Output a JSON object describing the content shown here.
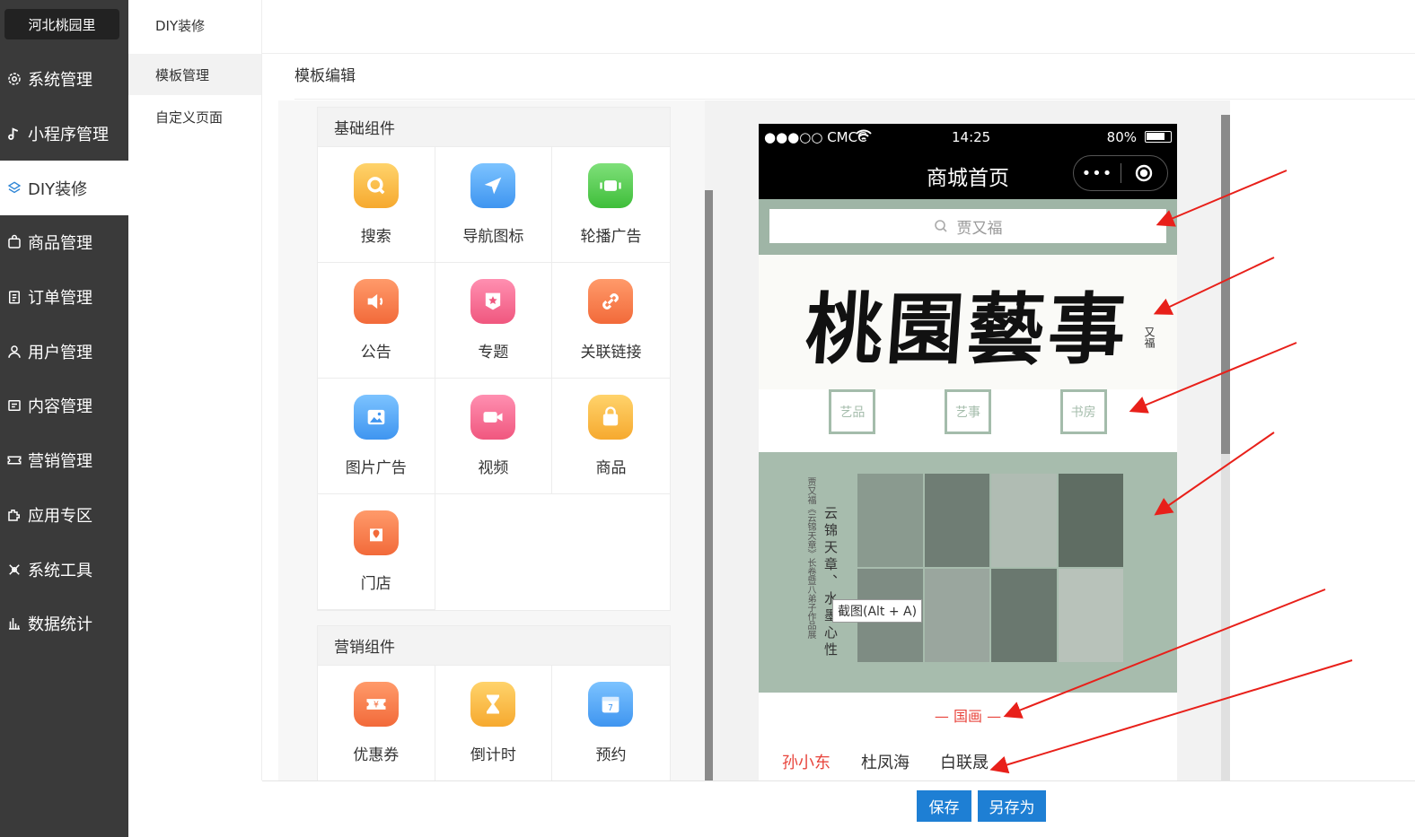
{
  "brand": "河北桃园里",
  "menu": [
    {
      "label": "系统管理",
      "icon": "gear-icon"
    },
    {
      "label": "小程序管理",
      "icon": "music-note-icon"
    },
    {
      "label": "DIY装修",
      "icon": "cube-icon"
    },
    {
      "label": "商品管理",
      "icon": "bag-icon"
    },
    {
      "label": "订单管理",
      "icon": "clipboard-icon"
    },
    {
      "label": "用户管理",
      "icon": "user-icon"
    },
    {
      "label": "内容管理",
      "icon": "document-icon"
    },
    {
      "label": "营销管理",
      "icon": "ticket-icon"
    },
    {
      "label": "应用专区",
      "icon": "puzzle-icon"
    },
    {
      "label": "系统工具",
      "icon": "wrench-icon"
    },
    {
      "label": "数据统计",
      "icon": "bar-chart-icon"
    }
  ],
  "subnav": {
    "title": "DIY装修",
    "items": [
      "模板管理",
      "自定义页面"
    ]
  },
  "page_title": "模板编辑",
  "groups": {
    "basic": {
      "title": "基础组件",
      "items": [
        "搜索",
        "导航图标",
        "轮播广告",
        "公告",
        "专题",
        "关联链接",
        "图片广告",
        "视频",
        "商品",
        "门店"
      ]
    },
    "marketing": {
      "title": "营销组件",
      "items": [
        "优惠券",
        "倒计时",
        "预约"
      ]
    }
  },
  "phone": {
    "carrier": "●●●○○ CMCC",
    "time": "14:25",
    "battery": "80%",
    "nav_title": "商城首页",
    "capsule_dots": "•••",
    "search_placeholder": "贾又福",
    "banner_text": "桃園藝事",
    "seal_text": "又福",
    "categories": [
      "艺品",
      "艺事",
      "书房"
    ],
    "poster_vertical_small": "贾又福《云锦天章》长卷暨八弟子作品展",
    "poster_vertical_large": "云锦天章、水墨心性",
    "tooltip": "截图(Alt + A)",
    "section_title": "— 国画 —",
    "names": [
      "孙小东",
      "杜凤海",
      "白联晟"
    ]
  },
  "buttons": {
    "save": "保存",
    "save_as": "另存为"
  },
  "colors": {
    "sidebar_bg": "#3a3a3a",
    "primary": "#1e7fd4",
    "accent_red": "#e8453c",
    "sage": "#a7bcad"
  }
}
